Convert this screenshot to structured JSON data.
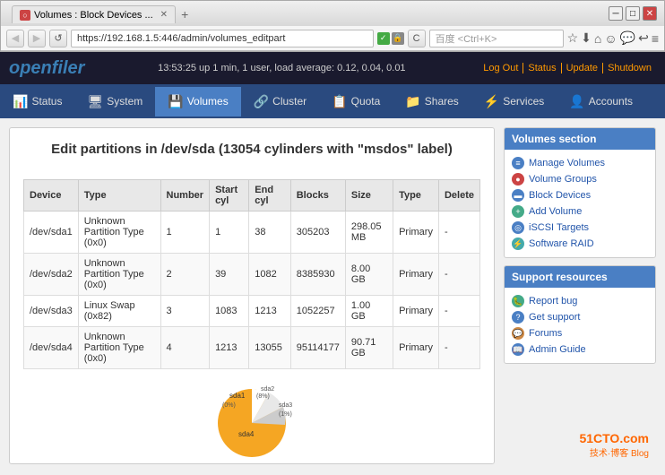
{
  "browser": {
    "tab_label": "Volumes : Block Devices ...",
    "url": "https://192.168.1.5:446/admin/volumes_editpart",
    "search_placeholder": "百度 <Ctrl+K>"
  },
  "topnav": {
    "logo": "openfiler",
    "status_text": "13:53:25 up 1 min, 1 user, load average: 0.12, 0.04, 0.01",
    "links": [
      "Log Out",
      "Status",
      "Update",
      "Shutdown"
    ]
  },
  "mainnav": {
    "items": [
      {
        "label": "Status",
        "icon": "📊",
        "active": false
      },
      {
        "label": "System",
        "icon": "⚙️",
        "active": false
      },
      {
        "label": "Volumes",
        "icon": "💾",
        "active": true
      },
      {
        "label": "Cluster",
        "icon": "🔗",
        "active": false
      },
      {
        "label": "Quota",
        "icon": "📋",
        "active": false
      },
      {
        "label": "Shares",
        "icon": "📁",
        "active": false
      },
      {
        "label": "Services",
        "icon": "⚡",
        "active": false
      },
      {
        "label": "Accounts",
        "icon": "👤",
        "active": false
      }
    ]
  },
  "page": {
    "title": "Edit partitions in /dev/sda (13054 cylinders with \"msdos\" label)"
  },
  "table": {
    "headers": [
      "Device",
      "Type",
      "Number",
      "Start cyl",
      "End cyl",
      "Blocks",
      "Size",
      "Type",
      "Delete"
    ],
    "rows": [
      {
        "device": "/dev/sda1",
        "type": "Unknown Partition Type (0x0)",
        "number": "1",
        "start_cyl": "1",
        "end_cyl": "38",
        "blocks": "305203",
        "size": "298.05 MB",
        "ptype": "Primary",
        "delete": "-"
      },
      {
        "device": "/dev/sda2",
        "type": "Unknown Partition Type (0x0)",
        "number": "2",
        "start_cyl": "39",
        "end_cyl": "1082",
        "blocks": "8385930",
        "size": "8.00 GB",
        "ptype": "Primary",
        "delete": "-"
      },
      {
        "device": "/dev/sda3",
        "type": "Linux Swap (0x82)",
        "number": "3",
        "start_cyl": "1083",
        "end_cyl": "1213",
        "blocks": "1052257",
        "size": "1.00 GB",
        "ptype": "Primary",
        "delete": "-"
      },
      {
        "device": "/dev/sda4",
        "type": "Unknown Partition Type (0x0)",
        "number": "4",
        "start_cyl": "1213",
        "end_cyl": "13055",
        "blocks": "95114177",
        "size": "90.71 GB",
        "ptype": "Primary",
        "delete": "-"
      }
    ]
  },
  "sidebar": {
    "volumes_section": {
      "title": "Volumes section",
      "links": [
        {
          "label": "Manage Volumes",
          "color": "blue"
        },
        {
          "label": "Volume Groups",
          "color": "red"
        },
        {
          "label": "Block Devices",
          "color": "blue"
        },
        {
          "label": "Add Volume",
          "color": "green"
        },
        {
          "label": "iSCSI Targets",
          "color": "blue"
        },
        {
          "label": "Software RAID",
          "color": "blue"
        }
      ]
    },
    "support_section": {
      "title": "Support resources",
      "links": [
        {
          "label": "Report bug",
          "color": "green"
        },
        {
          "label": "Get support",
          "color": "blue"
        },
        {
          "label": "Forums",
          "color": "orange"
        },
        {
          "label": "Admin Guide",
          "color": "blue"
        }
      ]
    }
  },
  "chart": {
    "labels": [
      "sda1",
      "sda2",
      "sda3",
      "sda4"
    ],
    "percentages": [
      "(0%)",
      "(8%)",
      "(1%)",
      "sda4"
    ]
  },
  "watermark": {
    "main": "51CTO.com",
    "sub": "技术·博客  Blog"
  }
}
